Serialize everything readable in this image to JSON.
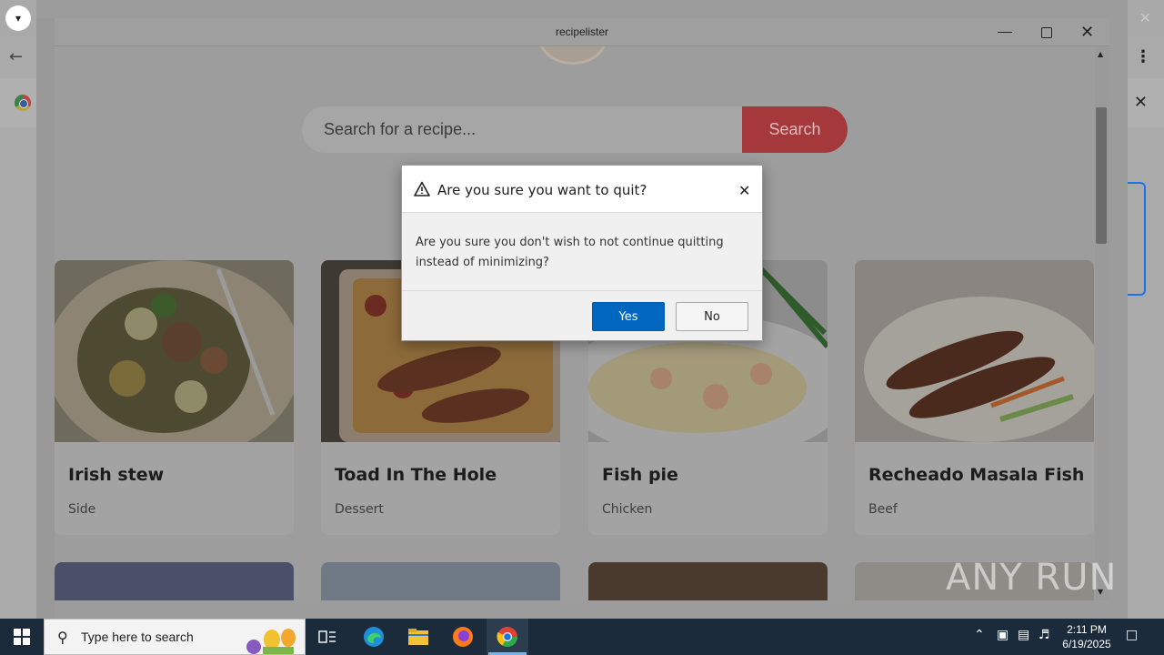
{
  "app": {
    "title": "recipelister",
    "search": {
      "placeholder": "Search for a recipe...",
      "button_label": "Search"
    }
  },
  "recipes": [
    {
      "title": "Irish stew",
      "category": "Side"
    },
    {
      "title": "Toad In The Hole",
      "category": "Dessert"
    },
    {
      "title": "Fish pie",
      "category": "Chicken"
    },
    {
      "title": "Recheado Masala Fish",
      "category": "Beef"
    }
  ],
  "dialog": {
    "title": "Are you sure you want to quit?",
    "message": "Are you sure you don't wish to not continue quitting instead of minimizing?",
    "yes_label": "Yes",
    "no_label": "No"
  },
  "watermark": "ANY RUN",
  "taskbar": {
    "search_placeholder": "Type here to search",
    "time": "2:11 PM",
    "date": "6/19/2025"
  },
  "colors": {
    "accent_blue": "#0067c0",
    "search_button": "#a5383a",
    "taskbar": "#1b2b3b"
  }
}
